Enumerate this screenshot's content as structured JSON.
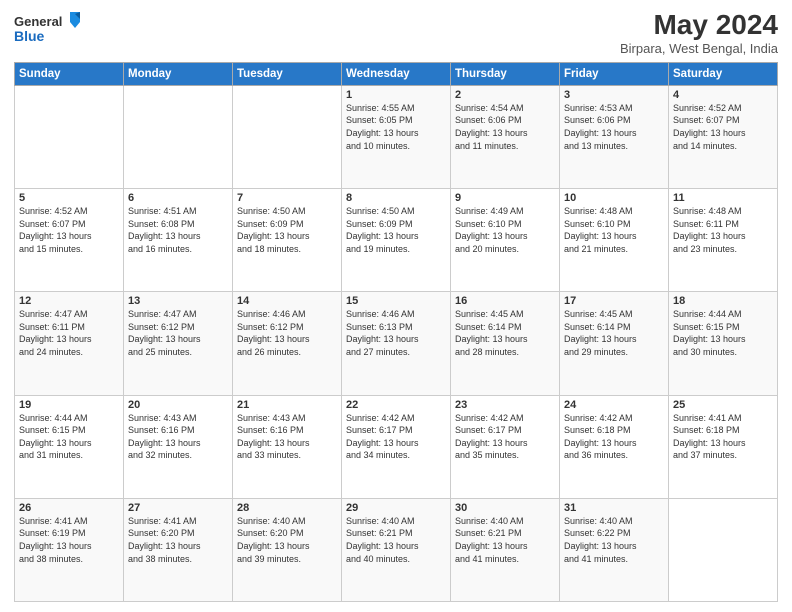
{
  "header": {
    "logo_general": "General",
    "logo_blue": "Blue",
    "title": "May 2024",
    "subtitle": "Birpara, West Bengal, India"
  },
  "weekdays": [
    "Sunday",
    "Monday",
    "Tuesday",
    "Wednesday",
    "Thursday",
    "Friday",
    "Saturday"
  ],
  "weeks": [
    [
      {
        "day": "",
        "info": ""
      },
      {
        "day": "",
        "info": ""
      },
      {
        "day": "",
        "info": ""
      },
      {
        "day": "1",
        "info": "Sunrise: 4:55 AM\nSunset: 6:05 PM\nDaylight: 13 hours\nand 10 minutes."
      },
      {
        "day": "2",
        "info": "Sunrise: 4:54 AM\nSunset: 6:06 PM\nDaylight: 13 hours\nand 11 minutes."
      },
      {
        "day": "3",
        "info": "Sunrise: 4:53 AM\nSunset: 6:06 PM\nDaylight: 13 hours\nand 13 minutes."
      },
      {
        "day": "4",
        "info": "Sunrise: 4:52 AM\nSunset: 6:07 PM\nDaylight: 13 hours\nand 14 minutes."
      }
    ],
    [
      {
        "day": "5",
        "info": "Sunrise: 4:52 AM\nSunset: 6:07 PM\nDaylight: 13 hours\nand 15 minutes."
      },
      {
        "day": "6",
        "info": "Sunrise: 4:51 AM\nSunset: 6:08 PM\nDaylight: 13 hours\nand 16 minutes."
      },
      {
        "day": "7",
        "info": "Sunrise: 4:50 AM\nSunset: 6:09 PM\nDaylight: 13 hours\nand 18 minutes."
      },
      {
        "day": "8",
        "info": "Sunrise: 4:50 AM\nSunset: 6:09 PM\nDaylight: 13 hours\nand 19 minutes."
      },
      {
        "day": "9",
        "info": "Sunrise: 4:49 AM\nSunset: 6:10 PM\nDaylight: 13 hours\nand 20 minutes."
      },
      {
        "day": "10",
        "info": "Sunrise: 4:48 AM\nSunset: 6:10 PM\nDaylight: 13 hours\nand 21 minutes."
      },
      {
        "day": "11",
        "info": "Sunrise: 4:48 AM\nSunset: 6:11 PM\nDaylight: 13 hours\nand 23 minutes."
      }
    ],
    [
      {
        "day": "12",
        "info": "Sunrise: 4:47 AM\nSunset: 6:11 PM\nDaylight: 13 hours\nand 24 minutes."
      },
      {
        "day": "13",
        "info": "Sunrise: 4:47 AM\nSunset: 6:12 PM\nDaylight: 13 hours\nand 25 minutes."
      },
      {
        "day": "14",
        "info": "Sunrise: 4:46 AM\nSunset: 6:12 PM\nDaylight: 13 hours\nand 26 minutes."
      },
      {
        "day": "15",
        "info": "Sunrise: 4:46 AM\nSunset: 6:13 PM\nDaylight: 13 hours\nand 27 minutes."
      },
      {
        "day": "16",
        "info": "Sunrise: 4:45 AM\nSunset: 6:14 PM\nDaylight: 13 hours\nand 28 minutes."
      },
      {
        "day": "17",
        "info": "Sunrise: 4:45 AM\nSunset: 6:14 PM\nDaylight: 13 hours\nand 29 minutes."
      },
      {
        "day": "18",
        "info": "Sunrise: 4:44 AM\nSunset: 6:15 PM\nDaylight: 13 hours\nand 30 minutes."
      }
    ],
    [
      {
        "day": "19",
        "info": "Sunrise: 4:44 AM\nSunset: 6:15 PM\nDaylight: 13 hours\nand 31 minutes."
      },
      {
        "day": "20",
        "info": "Sunrise: 4:43 AM\nSunset: 6:16 PM\nDaylight: 13 hours\nand 32 minutes."
      },
      {
        "day": "21",
        "info": "Sunrise: 4:43 AM\nSunset: 6:16 PM\nDaylight: 13 hours\nand 33 minutes."
      },
      {
        "day": "22",
        "info": "Sunrise: 4:42 AM\nSunset: 6:17 PM\nDaylight: 13 hours\nand 34 minutes."
      },
      {
        "day": "23",
        "info": "Sunrise: 4:42 AM\nSunset: 6:17 PM\nDaylight: 13 hours\nand 35 minutes."
      },
      {
        "day": "24",
        "info": "Sunrise: 4:42 AM\nSunset: 6:18 PM\nDaylight: 13 hours\nand 36 minutes."
      },
      {
        "day": "25",
        "info": "Sunrise: 4:41 AM\nSunset: 6:18 PM\nDaylight: 13 hours\nand 37 minutes."
      }
    ],
    [
      {
        "day": "26",
        "info": "Sunrise: 4:41 AM\nSunset: 6:19 PM\nDaylight: 13 hours\nand 38 minutes."
      },
      {
        "day": "27",
        "info": "Sunrise: 4:41 AM\nSunset: 6:20 PM\nDaylight: 13 hours\nand 38 minutes."
      },
      {
        "day": "28",
        "info": "Sunrise: 4:40 AM\nSunset: 6:20 PM\nDaylight: 13 hours\nand 39 minutes."
      },
      {
        "day": "29",
        "info": "Sunrise: 4:40 AM\nSunset: 6:21 PM\nDaylight: 13 hours\nand 40 minutes."
      },
      {
        "day": "30",
        "info": "Sunrise: 4:40 AM\nSunset: 6:21 PM\nDaylight: 13 hours\nand 41 minutes."
      },
      {
        "day": "31",
        "info": "Sunrise: 4:40 AM\nSunset: 6:22 PM\nDaylight: 13 hours\nand 41 minutes."
      },
      {
        "day": "",
        "info": ""
      }
    ]
  ]
}
